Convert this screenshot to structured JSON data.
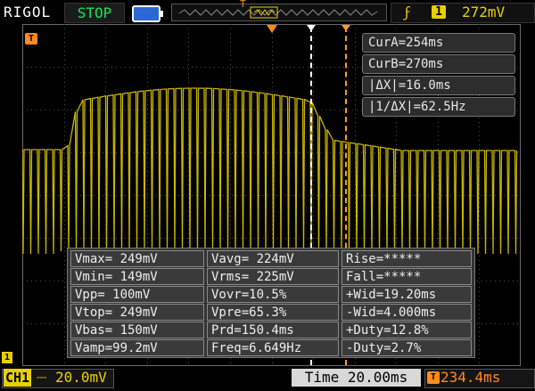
{
  "header": {
    "brand": "RIGOL",
    "run_status": "STOP",
    "trigger_source": "1",
    "trigger_level": "272mV",
    "trigger_edge_icon": "rising-edge-icon"
  },
  "markers": {
    "trace_label": "T",
    "channel_marker": "1",
    "offset_label": "T"
  },
  "cursor_readout": {
    "cur_a": "CurA=254ms",
    "cur_b": "CurB=270ms",
    "delta_x": "|ΔX|=16.0ms",
    "inv_delta_x": "|1/ΔX|=62.5Hz"
  },
  "measurements": {
    "col1": [
      "Vmax= 249mV",
      "Vmin= 149mV",
      "Vpp= 100mV",
      "Vtop= 249mV",
      "Vbas= 150mV",
      "Vamp=99.2mV"
    ],
    "col2": [
      "Vavg= 224mV",
      "Vrms= 225mV",
      "Vovr=10.5%",
      "Vpre=65.3%",
      "Prd=150.4ms",
      "Freq=6.649Hz"
    ],
    "col3": [
      "Rise=*****",
      "Fall=*****",
      "+Wid=19.20ms",
      "-Wid=4.000ms",
      "+Duty=12.8%",
      "-Duty=2.7%"
    ]
  },
  "footer": {
    "ch1_label": "CH1",
    "ch1_coupling_icon": "dc-coupling-icon",
    "ch1_scale": "20.0mV",
    "timebase": "Time 20.00ms",
    "horizontal_offset": "234.4ms"
  },
  "colors": {
    "trace": "#c8b400",
    "grid": "#5a5a5a",
    "stop": "#19e35a",
    "trigger": "#ff8a1e",
    "channel": "#e8d000"
  }
}
